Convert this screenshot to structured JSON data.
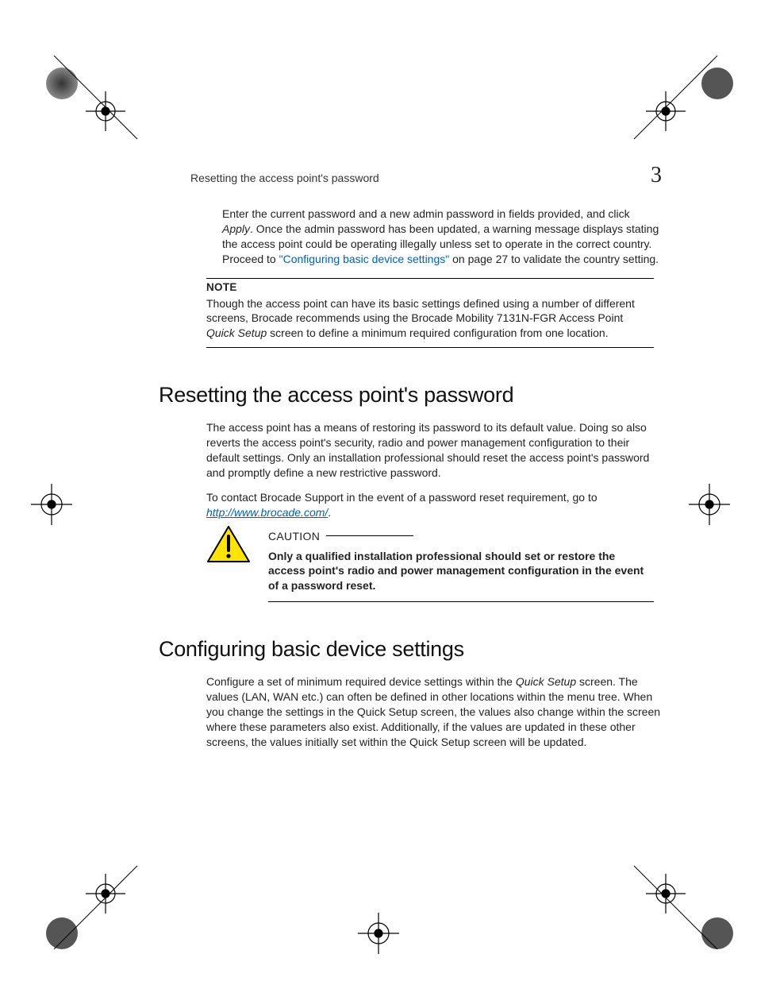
{
  "header": {
    "running_title": "Resetting the access point's password",
    "chapter_number": "3"
  },
  "intro": {
    "text_before_link": "Enter the current password and a new admin password in fields provided, and click ",
    "italic_apply": "Apply",
    "text_after_apply": ". Once the admin password has been updated, a warning message displays stating the access point could be operating illegally unless set to operate in the correct country. Proceed to ",
    "link_text": "\"Configuring basic device settings\"",
    "text_after_link": " on page 27 to validate the country setting."
  },
  "note": {
    "label": "NOTE",
    "body_before_italic": "Though the access point can have its basic settings defined using a number of different screens, Brocade recommends using the Brocade Mobility 7131N-FGR Access Point ",
    "italic": "Quick Setup",
    "body_after_italic": " screen to define a minimum required configuration from one location."
  },
  "section1": {
    "heading": "Resetting the access point's password",
    "para1": "The access point has a means of restoring its password to its default value. Doing so also reverts the access point's security, radio and power management configuration to their default settings. Only an installation professional should reset the access point's password and promptly define a new restrictive password.",
    "para2_before": "To contact Brocade Support in the event of a password reset requirement, go to ",
    "para2_link": "http://www.brocade.com/",
    "para2_after": "."
  },
  "caution": {
    "label": "CAUTION",
    "body": "Only a qualified installation professional should set or restore the access point's radio and power management configuration in the event of a password reset."
  },
  "section2": {
    "heading": "Configuring basic device settings",
    "para_before_italic": "Configure a set of minimum required device settings within the ",
    "italic": "Quick Setup",
    "para_after_italic": " screen. The values (LAN, WAN etc.) can often be defined in other locations within the menu tree. When you change the settings in the Quick Setup screen, the values also change within the screen where these parameters also exist. Additionally, if the values are updated in these other screens, the values initially set within the Quick Setup screen will be updated."
  }
}
